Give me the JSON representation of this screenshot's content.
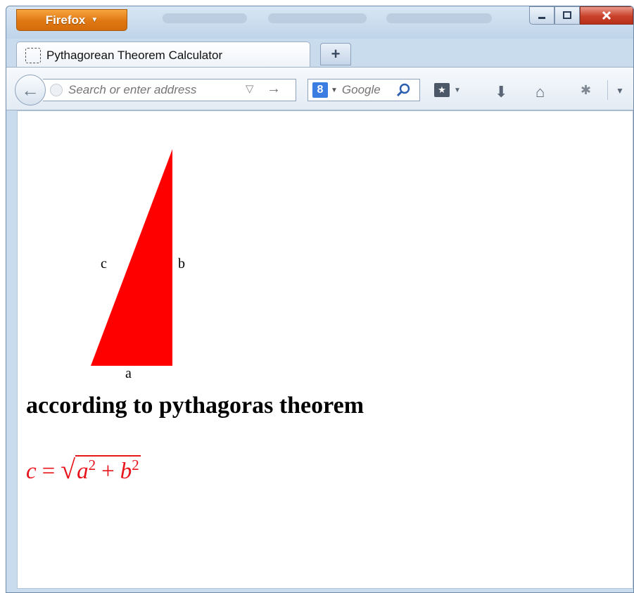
{
  "browser": {
    "menu_button_label": "Firefox",
    "menu_button_caret": "▼"
  },
  "tab": {
    "title": "Pythagorean Theorem Calculator"
  },
  "newtab": {
    "label": "+"
  },
  "navbar": {
    "url_placeholder": "Search or enter address",
    "search_placeholder": "Google",
    "search_engine_glyph": "8"
  },
  "page": {
    "triangle_color": "#ff0000",
    "labels": {
      "c": "c",
      "b": "b",
      "a": "a"
    },
    "heading": "according to pythagoras theorem",
    "formula": {
      "lhs": "c",
      "eq": "=",
      "radical": "√",
      "a": "a",
      "a_exp": "2",
      "plus": "+",
      "b": "b",
      "b_exp": "2",
      "color": "#e8141b"
    }
  },
  "colors": {
    "firefox_orange": "#e07712",
    "chrome_blue": "#c9dcee"
  }
}
